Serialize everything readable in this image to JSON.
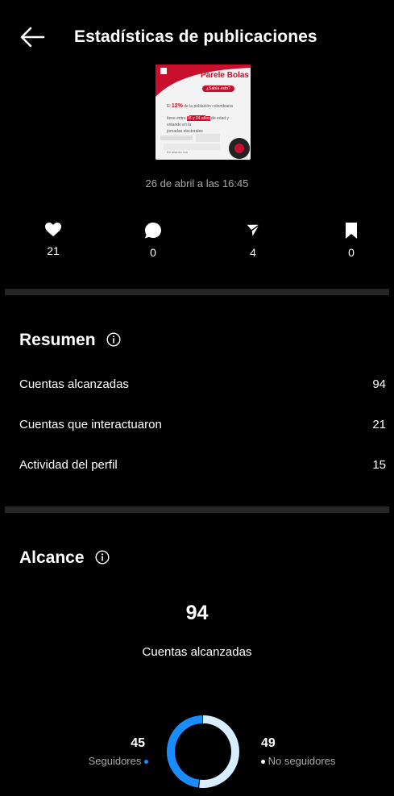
{
  "header": {
    "title": "Estadísticas de publicaciones",
    "back_icon": "arrow-left-icon"
  },
  "post": {
    "thumbnail": {
      "heading": "Párele Bolas",
      "badge": "¿Sabía esto?",
      "line1_prefix": "El",
      "line1_highlight": "12%",
      "line1_suffix": "de la población colombiana",
      "line2_prefix": "tiene entre",
      "line2_highlight": "18 y 24 años",
      "line2_suffix": "de edad y",
      "line3": "votando en la",
      "line4": "jornadas electorales",
      "footer": "En alianza con"
    },
    "date": "26 de abril a las 16:45"
  },
  "engagement": [
    {
      "icon": "heart-icon",
      "value": "21"
    },
    {
      "icon": "comment-icon",
      "value": "0"
    },
    {
      "icon": "send-icon",
      "value": "4"
    },
    {
      "icon": "bookmark-icon",
      "value": "0"
    }
  ],
  "resumen": {
    "title": "Resumen",
    "rows": [
      {
        "label": "Cuentas alcanzadas",
        "value": "94"
      },
      {
        "label": "Cuentas que interactuaron",
        "value": "21"
      },
      {
        "label": "Actividad del perfil",
        "value": "15"
      }
    ]
  },
  "alcance": {
    "title": "Alcance",
    "total": "94",
    "total_label": "Cuentas alcanzadas",
    "followers": {
      "value": "45",
      "label": "Seguidores",
      "color": "#1a8cff"
    },
    "non_followers": {
      "value": "49",
      "label": "No seguidores",
      "color": "#d6ecff"
    }
  },
  "chart_data": {
    "type": "pie",
    "categories": [
      "Seguidores",
      "No seguidores"
    ],
    "values": [
      45,
      49
    ]
  },
  "colors": {
    "background": "#000000",
    "divider": "#262626",
    "secondary_text": "#a8a8a8",
    "accent_red": "#c8102e"
  }
}
